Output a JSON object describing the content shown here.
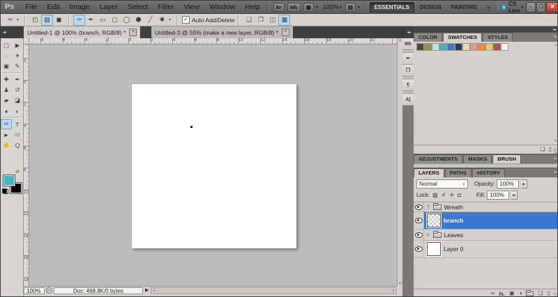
{
  "menu": {
    "logo": "Ps",
    "items": [
      "File",
      "Edit",
      "Image",
      "Layer",
      "Select",
      "Filter",
      "View",
      "Window",
      "Help"
    ],
    "bridge_label": "Br",
    "mini_bridge_label": "Mb",
    "zoom_level": "100%",
    "workspaces": [
      "ESSENTIALS",
      "DESIGN",
      "PAINTING"
    ],
    "active_workspace": "ESSENTIALS",
    "workspace_overflow": "»",
    "cs_live_label": "CS Live",
    "window_buttons": {
      "minimize": "–",
      "restore": "❐",
      "close": "✕"
    }
  },
  "options_bar": {
    "auto_add_delete_label": "Auto Add/Delete",
    "checkbox_checked": true
  },
  "document_tabs": [
    {
      "title": "Untitled-1 @ 100% (branch, RGB/8) *",
      "active": true
    },
    {
      "title": "Untitled-3 @ 55% (make a new layer, RGB/8) *",
      "active": false
    }
  ],
  "rulers": {
    "h": [
      "8",
      "6",
      "4",
      "2",
      "0",
      "2",
      "4",
      "6",
      "8",
      "10",
      "12",
      "14",
      "16",
      "18",
      "20",
      "22"
    ],
    "v": [
      "2",
      "0",
      "2",
      "4",
      "6",
      "8",
      "10",
      "12",
      "14",
      "16",
      "18"
    ]
  },
  "tools": [
    {
      "name": "rectangular-marquee",
      "glyph": "▢"
    },
    {
      "name": "move",
      "glyph": "▶"
    },
    {
      "name": "lasso",
      "glyph": "◌"
    },
    {
      "name": "quick-selection",
      "glyph": "✦"
    },
    {
      "name": "crop",
      "glyph": "▣"
    },
    {
      "name": "eyedropper",
      "glyph": "✎"
    },
    {
      "name": "spot-healing-brush",
      "glyph": "✚"
    },
    {
      "name": "brush",
      "glyph": "✒"
    },
    {
      "name": "clone-stamp",
      "glyph": "♟"
    },
    {
      "name": "history-brush",
      "glyph": "↺"
    },
    {
      "name": "eraser",
      "glyph": "▰"
    },
    {
      "name": "gradient",
      "glyph": "◪"
    },
    {
      "name": "blur",
      "glyph": "♦"
    },
    {
      "name": "dodge",
      "glyph": "◐"
    },
    {
      "name": "pen",
      "glyph": "✑",
      "selected": true
    },
    {
      "name": "type",
      "glyph": "T"
    },
    {
      "name": "path-selection",
      "glyph": "►"
    },
    {
      "name": "rectangle-shape",
      "glyph": "▭"
    },
    {
      "name": "hand",
      "glyph": "☝"
    },
    {
      "name": "zoom",
      "glyph": "Q"
    }
  ],
  "tool_colors": {
    "foreground": "#3bb7c8",
    "background": "#000000"
  },
  "shape_options": {
    "preset_glyph": "✑",
    "modes": [
      {
        "name": "shape-layers",
        "glyph": "◰"
      },
      {
        "name": "paths",
        "glyph": "▨",
        "selected": true
      },
      {
        "name": "fill-pixels",
        "glyph": "◼"
      }
    ],
    "shapes": [
      {
        "name": "pen",
        "glyph": "✑",
        "selected": true
      },
      {
        "name": "freeform-pen",
        "glyph": "✒"
      },
      {
        "name": "rectangle",
        "glyph": "▭"
      },
      {
        "name": "rounded-rectangle",
        "glyph": "▢"
      },
      {
        "name": "ellipse",
        "glyph": "◯"
      },
      {
        "name": "polygon",
        "glyph": "⬢"
      },
      {
        "name": "line",
        "glyph": "╱"
      },
      {
        "name": "custom-shape",
        "glyph": "✱"
      }
    ],
    "path_ops": [
      {
        "name": "add-to-path-area",
        "glyph": "❏"
      },
      {
        "name": "subtract-from-path-area",
        "glyph": "❐"
      },
      {
        "name": "intersect-path-areas",
        "glyph": "◫"
      },
      {
        "name": "exclude-overlapping-areas",
        "glyph": "▦",
        "selected": true
      }
    ]
  },
  "dock_icons": [
    {
      "name": "mini-bridge",
      "glyph": "Mb"
    },
    {
      "name": "tool-presets",
      "glyph": "✒"
    },
    {
      "name": "clone-source",
      "glyph": "❐"
    },
    {
      "name": "paragraph",
      "glyph": "¶"
    },
    {
      "name": "character",
      "glyph": "A|"
    }
  ],
  "panels": {
    "colors_group": {
      "tabs": [
        "COLOR",
        "SWATCHES",
        "STYLES"
      ],
      "active_tab": "SWATCHES",
      "swatches": [
        "#4a473d",
        "#8f9148",
        "#c2e2e9",
        "#3bb7c8",
        "#3a7ab6",
        "#20416f",
        "#ead9b0",
        "#f38e9d",
        "#ee8a3b",
        "#e9cf5a",
        "#a85647",
        "#f3f1ec"
      ]
    },
    "adjust_group": {
      "tabs": [
        "ADJUSTMENTS",
        "MASKS",
        "BRUSH"
      ],
      "active_tab": "BRUSH"
    },
    "layers_group": {
      "tabs": [
        "LAYERS",
        "PATHS",
        "HISTORY"
      ],
      "active_tab": "LAYERS",
      "blend_mode": "Normal",
      "opacity_label": "Opacity:",
      "opacity_value": "100%",
      "lock_label": "Lock:",
      "fill_label": "Fill:",
      "fill_value": "100%",
      "rows": [
        {
          "name": "Wreath",
          "kind": "group",
          "state": "expanded",
          "selected": false
        },
        {
          "name": "branch",
          "kind": "layer",
          "thumb": "transparent",
          "selected": true
        },
        {
          "name": "Leaves",
          "kind": "group",
          "state": "collapsed",
          "selected": false
        },
        {
          "name": "Layer 0",
          "kind": "layer",
          "thumb": "white",
          "selected": false
        }
      ]
    }
  },
  "status_bar": {
    "zoom": "100%",
    "doc_info": "Doc: 468.8K/0 bytes"
  },
  "glyphs": {
    "dropdown": "▾",
    "dropdown_small": "∨",
    "spinner": "▶",
    "collapse_left": "◂◂",
    "collapse_right": "▸▸",
    "panel_menu": "≡",
    "check": "✓",
    "close_small": "×",
    "scroll_up": "▲",
    "scroll_down": "▼",
    "scroll_left": "◂",
    "scroll_right": "▸",
    "tri_expanded": "▽",
    "tri_collapsed": "▷",
    "swap": "⇄",
    "link": "∞",
    "fx": "fx.",
    "mask": "▣",
    "adjustment": "◑",
    "new_item": "❏",
    "delete_item": "▯",
    "lock_transparency": "▨",
    "lock_image": "✐",
    "lock_position": "✛",
    "lock_all": "◘"
  },
  "ui_colors": {
    "selection_blue": "#3b78cf",
    "tool_highlight": "#b9d7f2",
    "close_button_red": "#c0504d"
  }
}
